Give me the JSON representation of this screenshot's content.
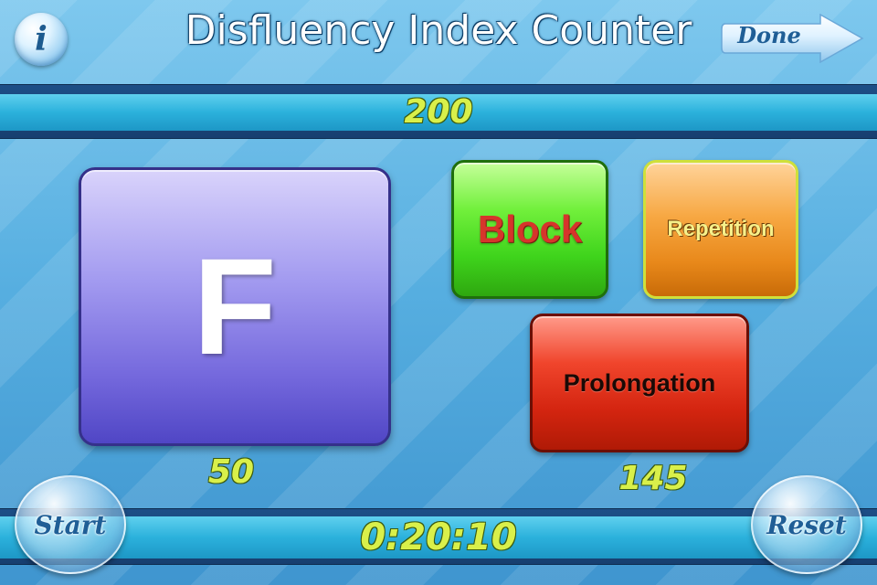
{
  "header": {
    "title": "Disfluency Index Counter",
    "info_label": "i",
    "done_label": "Done"
  },
  "total_count": "200",
  "buttons": {
    "fluent_label": "F",
    "block_label": "Block",
    "repetition_label": "Repetition",
    "prolongation_label": "Prolongation"
  },
  "counts": {
    "fluent": "50",
    "disfluent": "145"
  },
  "footer": {
    "timer": "0:20:10",
    "start_label": "Start",
    "reset_label": "Reset"
  },
  "colors": {
    "accent_yellow": "#d9f04a",
    "band_dark": "#173f70",
    "band_light": "#2bb1dc"
  }
}
